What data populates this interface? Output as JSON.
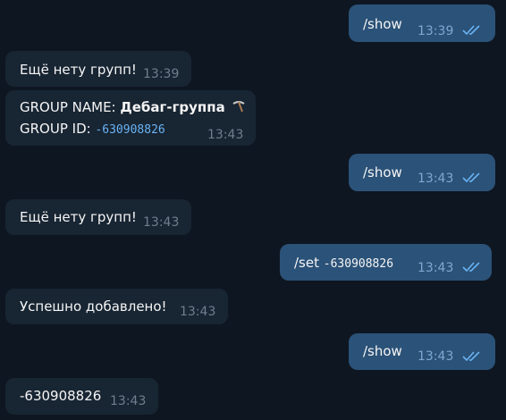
{
  "messages": [
    {
      "direction": "out",
      "text": "/show",
      "time": "13:39",
      "status": "read"
    },
    {
      "direction": "in",
      "text": "Ещё нету групп!",
      "time": "13:39"
    },
    {
      "direction": "in",
      "group_name_label": "GROUP NAME: ",
      "group_name_value": "Дебаг-группа",
      "group_name_icon": "pick-icon",
      "group_id_label": "GROUP ID: ",
      "group_id_value": "-630908826",
      "time": "13:43"
    },
    {
      "direction": "out",
      "text": "/show",
      "time": "13:43",
      "status": "read"
    },
    {
      "direction": "in",
      "text": "Ещё нету групп!",
      "time": "13:43"
    },
    {
      "direction": "out",
      "command": "/set",
      "argument": "-630908826",
      "time": "13:43",
      "status": "read"
    },
    {
      "direction": "in",
      "text": "Успешно добавлено!",
      "time": "13:43"
    },
    {
      "direction": "out",
      "text": "/show",
      "time": "13:43",
      "status": "read"
    },
    {
      "direction": "in",
      "text": "-630908826",
      "time": "13:43"
    }
  ],
  "colors": {
    "background": "#0e1621",
    "incoming_bubble": "#182533",
    "outgoing_bubble": "#2b5278",
    "read_check": "#6ab3f3",
    "code_text": "#6ab3f3"
  }
}
